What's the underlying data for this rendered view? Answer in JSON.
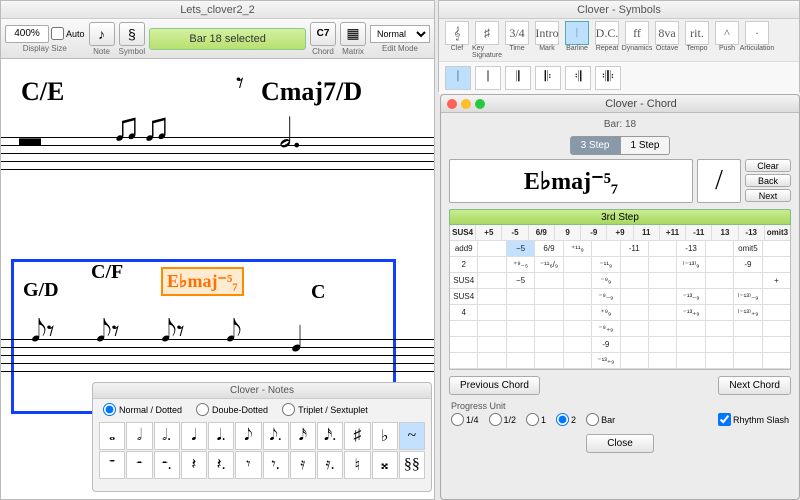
{
  "main": {
    "title": "Lets_clover2_2",
    "zoom": "400%",
    "auto_label": "Auto",
    "display_size_label": "Display Size",
    "note_label": "Note",
    "symbol_label": "Symbol",
    "bar_selected": "Bar 18 selected",
    "c7_label": "C7",
    "chord_label": "Chord",
    "matrix_label": "Matrix",
    "edit_mode_label": "Edit Mode",
    "mode_value": "Normal",
    "chords": {
      "c_e": "C/E",
      "cmaj7_d": "Cmaj7/D",
      "g_d": "G/D",
      "c_f": "C/F",
      "emaj": "E♭maj⁻⁵₇",
      "c": "C"
    }
  },
  "symbols": {
    "title": "Clover - Symbols",
    "items": [
      "Clef",
      "Key Signature",
      "Time",
      "Mark",
      "Barline",
      "Repeat",
      "Dynamics",
      "Octave",
      "Tempo",
      "Push",
      "Articulation"
    ],
    "icons": [
      "𝄞",
      "♯",
      "3/4",
      "Intro",
      "𝄀",
      "D.C.",
      "ff",
      "8va",
      "rit.",
      "^",
      "·"
    ]
  },
  "chord": {
    "title": "Clover - Chord",
    "bar_label": "Bar: 18",
    "tab1": "3 Step",
    "tab2": "1 Step",
    "display": "E♭maj⁻⁵₇",
    "slash": "/",
    "btn_clear": "Clear",
    "btn_back": "Back",
    "btn_next": "Next",
    "step_header": "3rd Step",
    "grid": [
      [
        "SUS4",
        "+5",
        "-5",
        "6/9",
        "9",
        "-9",
        "+9",
        "11",
        "+11",
        "-11",
        "13",
        "-13",
        "omit3"
      ],
      [
        "add9",
        "",
        "−5",
        "6/9",
        "⁺¹¹₉",
        "",
        "-11",
        "",
        "-13",
        "",
        "omit5",
        ""
      ],
      [
        "2",
        "",
        "⁺⁹₋₅",
        "⁻¹¹₆/₉",
        "",
        "⁻¹¹₉",
        "",
        "",
        "⁽⁻¹³⁾₉",
        "",
        "-9",
        ""
      ],
      [
        "SUS4",
        "",
        "−5",
        "",
        "",
        "⁻⁹₉",
        "",
        "",
        "",
        "",
        "",
        "+"
      ],
      [
        "SUS4",
        "",
        "",
        "",
        "",
        "⁻⁹₋₉",
        "",
        "",
        "⁻¹³₋₉",
        "",
        "⁽⁻¹³⁾₋₉",
        ""
      ],
      [
        "4",
        "",
        "",
        "",
        "",
        "⁺⁹₉",
        "",
        "",
        "⁻¹³₊₉",
        "",
        "⁽⁻¹³⁾₊₉",
        ""
      ],
      [
        "",
        "",
        "",
        "",
        "",
        "⁻⁹₊₉",
        "",
        "",
        "",
        "",
        "",
        ""
      ],
      [
        "",
        "",
        "",
        "",
        "",
        "-9",
        "",
        "",
        "",
        "",
        "",
        ""
      ],
      [
        "",
        "",
        "",
        "",
        "",
        "⁻¹³₊₉",
        "",
        "",
        "",
        "",
        "",
        ""
      ]
    ],
    "prev": "Previous Chord",
    "next_chord": "Next Chord",
    "unit_label": "Progress Unit",
    "units": [
      "1/4",
      "1/2",
      "1",
      "2",
      "Bar"
    ],
    "rhythm_slash": "Rhythm Slash",
    "close": "Close"
  },
  "notes": {
    "title": "Clover - Notes",
    "rhythm": [
      "Normal / Dotted",
      "Doube-Dotted",
      "Triplet / Sextuplet"
    ],
    "row1": [
      "𝅝",
      "𝅗𝅥",
      "𝅗𝅥.",
      "𝅘𝅥",
      "𝅘𝅥.",
      "𝅘𝅥𝅮",
      "𝅘𝅥𝅮.",
      "𝅘𝅥𝅯",
      "𝅘𝅥𝅯.",
      "♯",
      "♭",
      "~"
    ],
    "row2": [
      "𝄻",
      "𝄼",
      "𝄼.",
      "𝄽",
      "𝄽.",
      "𝄾",
      "𝄾.",
      "𝄿",
      "𝄿.",
      "♮",
      "𝄪",
      "§§"
    ]
  }
}
